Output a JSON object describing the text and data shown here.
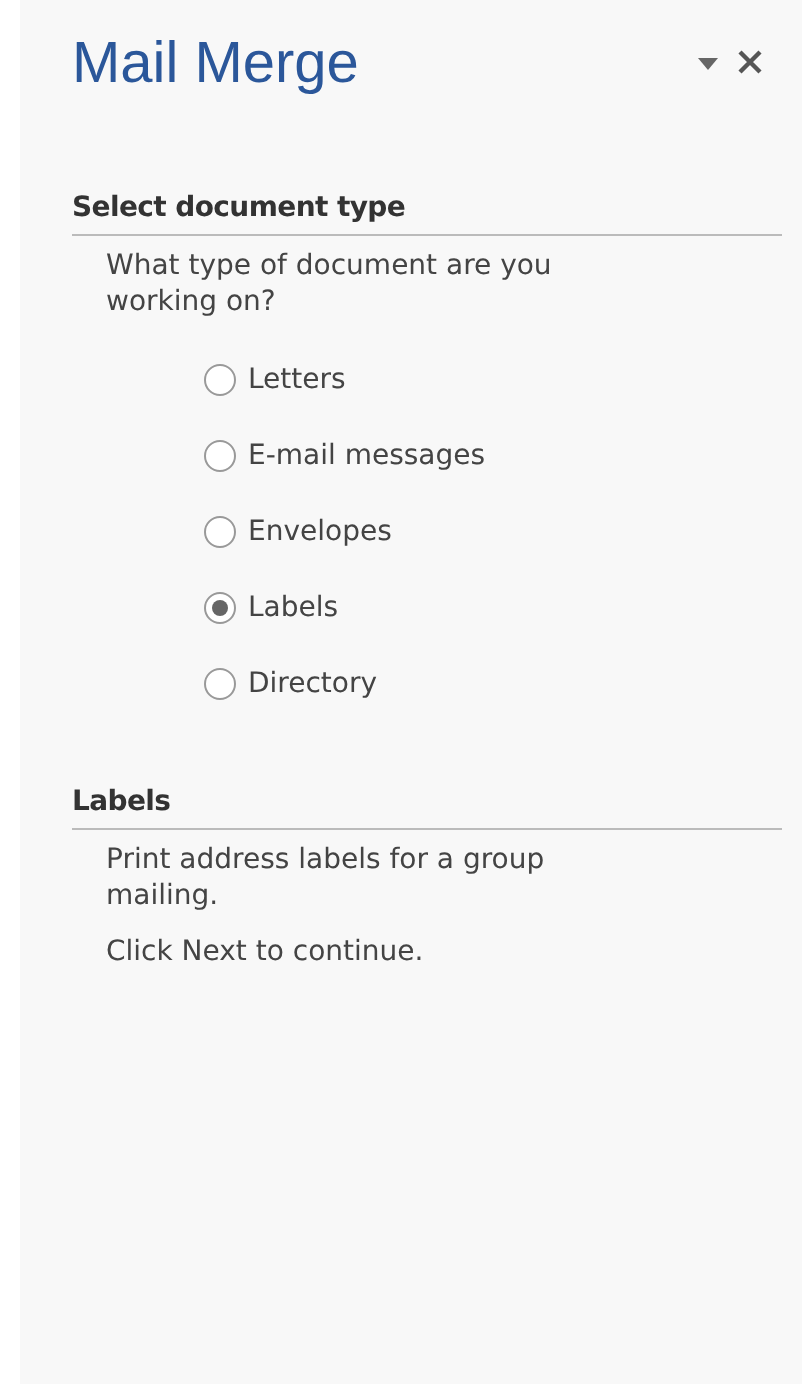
{
  "pane": {
    "title": "Mail Merge"
  },
  "sections": [
    {
      "heading": "Select document type",
      "paragraphs": [
        "What type of document are you working on?"
      ],
      "options": [
        {
          "label": "Letters",
          "selected": false
        },
        {
          "label": "E-mail messages",
          "selected": false
        },
        {
          "label": "Envelopes",
          "selected": false
        },
        {
          "label": "Labels",
          "selected": true
        },
        {
          "label": "Directory",
          "selected": false
        }
      ]
    },
    {
      "heading": "Labels",
      "paragraphs": [
        "Print address labels for a group mailing.",
        "Click Next to continue."
      ]
    }
  ]
}
